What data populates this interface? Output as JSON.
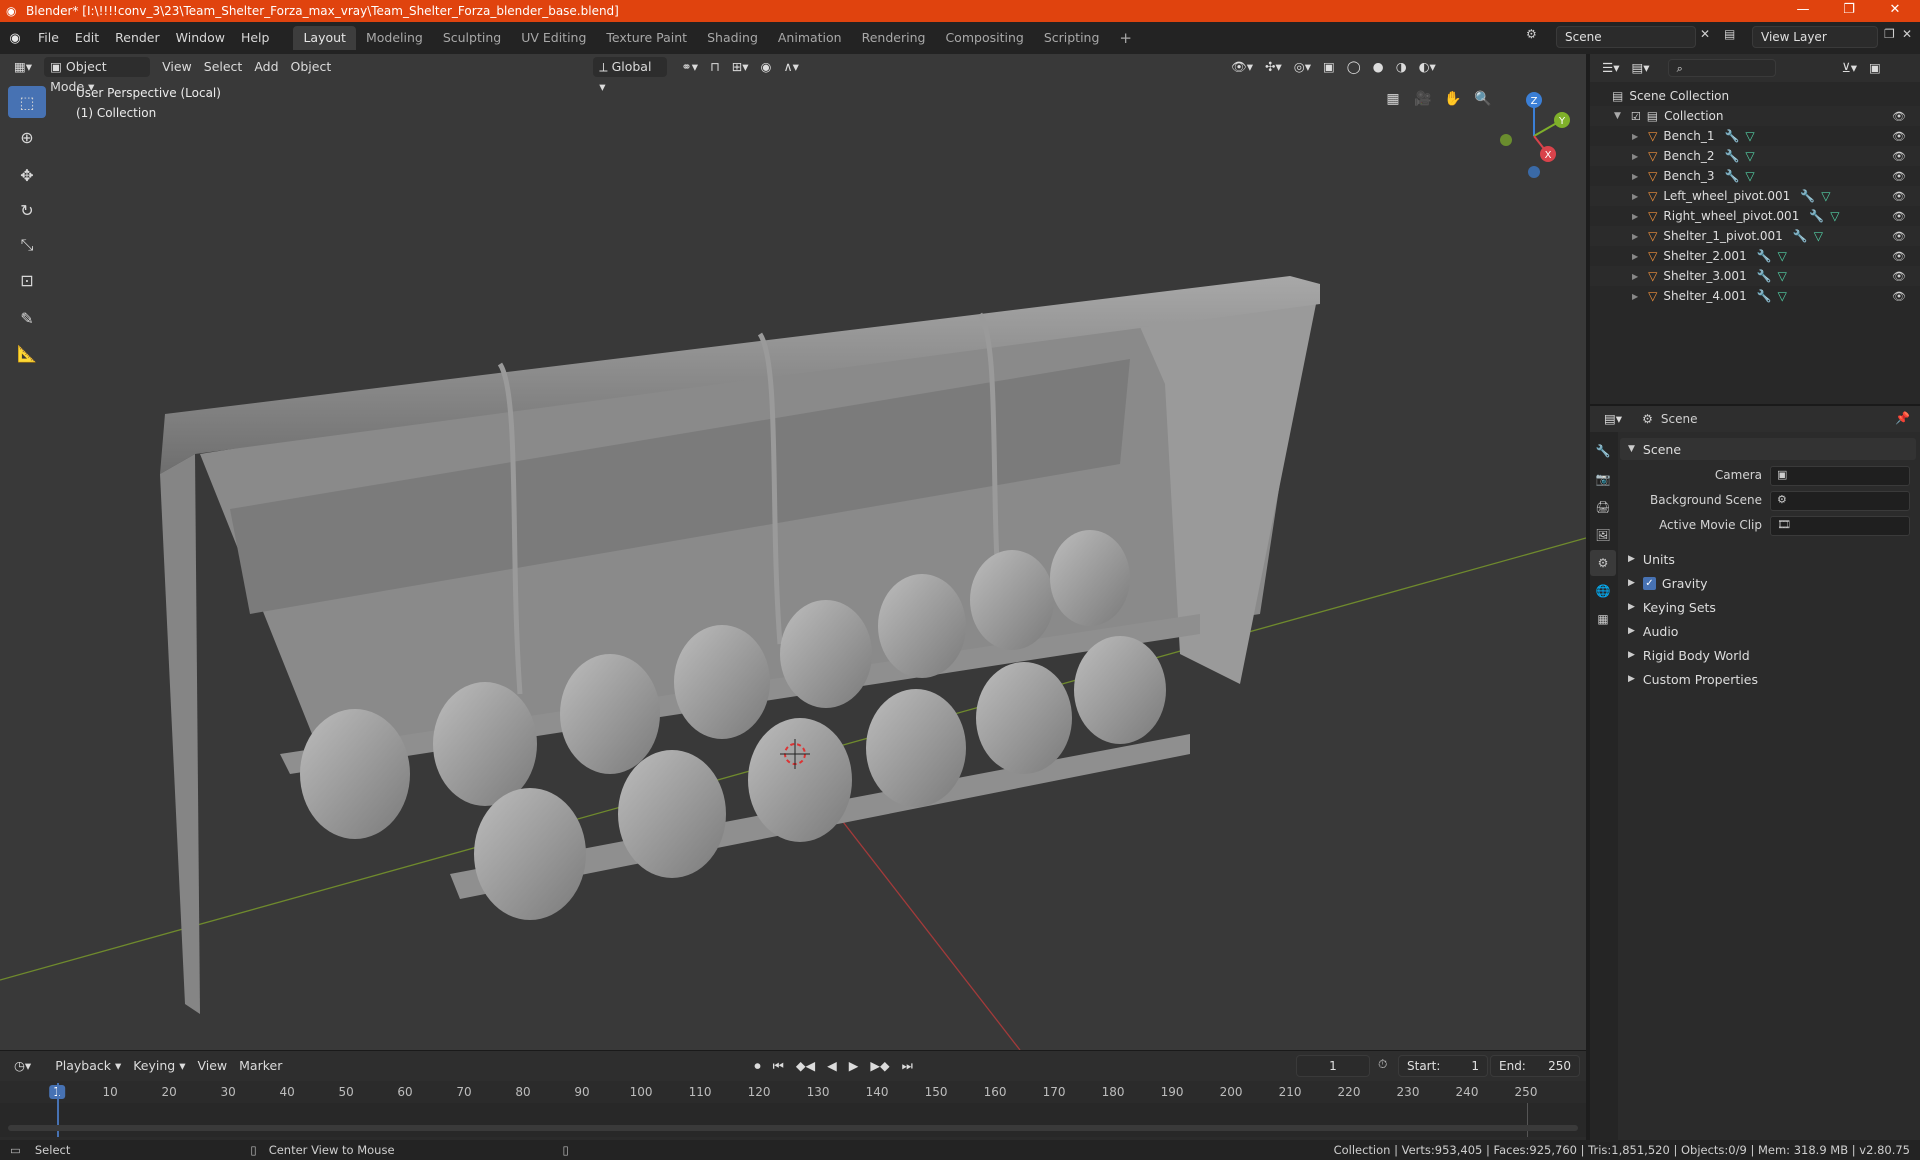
{
  "window": {
    "title": "Blender* [I:\\!!!!conv_3\\23\\Team_Shelter_Forza_max_vray\\Team_Shelter_Forza_blender_base.blend]",
    "minimize": "—",
    "restore": "❐",
    "close": "✕"
  },
  "menu": [
    "File",
    "Edit",
    "Render",
    "Window",
    "Help"
  ],
  "workspaces": [
    "Layout",
    "Modeling",
    "Sculpting",
    "UV Editing",
    "Texture Paint",
    "Shading",
    "Animation",
    "Rendering",
    "Compositing",
    "Scripting"
  ],
  "active_workspace": "Layout",
  "add_workspace": "+",
  "scene_selector": {
    "value": "Scene"
  },
  "view_layer_selector": {
    "value": "View Layer"
  },
  "viewport": {
    "mode": "Object Mode",
    "header_menus": [
      "View",
      "Select",
      "Add",
      "Object"
    ],
    "transform_orientation": "Global",
    "overlay_line1": "User Perspective (Local)",
    "overlay_line2": "(1) Collection",
    "gizmo": {
      "x": "X",
      "y": "Y",
      "z": "Z"
    }
  },
  "outliner": {
    "root": "Scene Collection",
    "collection": "Collection",
    "objects": [
      "Bench_1",
      "Bench_2",
      "Bench_3",
      "Left_wheel_pivot.001",
      "Right_wheel_pivot.001",
      "Shelter_1_pivot.001",
      "Shelter_2.001",
      "Shelter_3.001",
      "Shelter_4.001"
    ]
  },
  "properties": {
    "context": "Scene",
    "panel_title": "Scene",
    "fields": [
      {
        "label": "Camera"
      },
      {
        "label": "Background Scene"
      },
      {
        "label": "Active Movie Clip"
      }
    ],
    "subpanels": [
      "Units",
      "Gravity",
      "Keying Sets",
      "Audio",
      "Rigid Body World",
      "Custom Properties"
    ],
    "gravity_checked": true
  },
  "timeline": {
    "menus": [
      "Playback",
      "Keying",
      "View",
      "Marker"
    ],
    "current_frame": "1",
    "start_label": "Start:",
    "start_value": "1",
    "end_label": "End:",
    "end_value": "250",
    "ruler": [
      "1",
      "10",
      "20",
      "30",
      "40",
      "50",
      "60",
      "70",
      "80",
      "90",
      "100",
      "110",
      "120",
      "130",
      "140",
      "150",
      "160",
      "170",
      "180",
      "190",
      "200",
      "210",
      "220",
      "230",
      "240",
      "250"
    ]
  },
  "statusbar": {
    "left_action": "Select",
    "middle_action": "Center View to Mouse",
    "stats": "Collection | Verts:953,405 | Faces:925,760 | Tris:1,851,520 | Objects:0/9 | Mem: 318.9 MB | v2.80.75"
  }
}
